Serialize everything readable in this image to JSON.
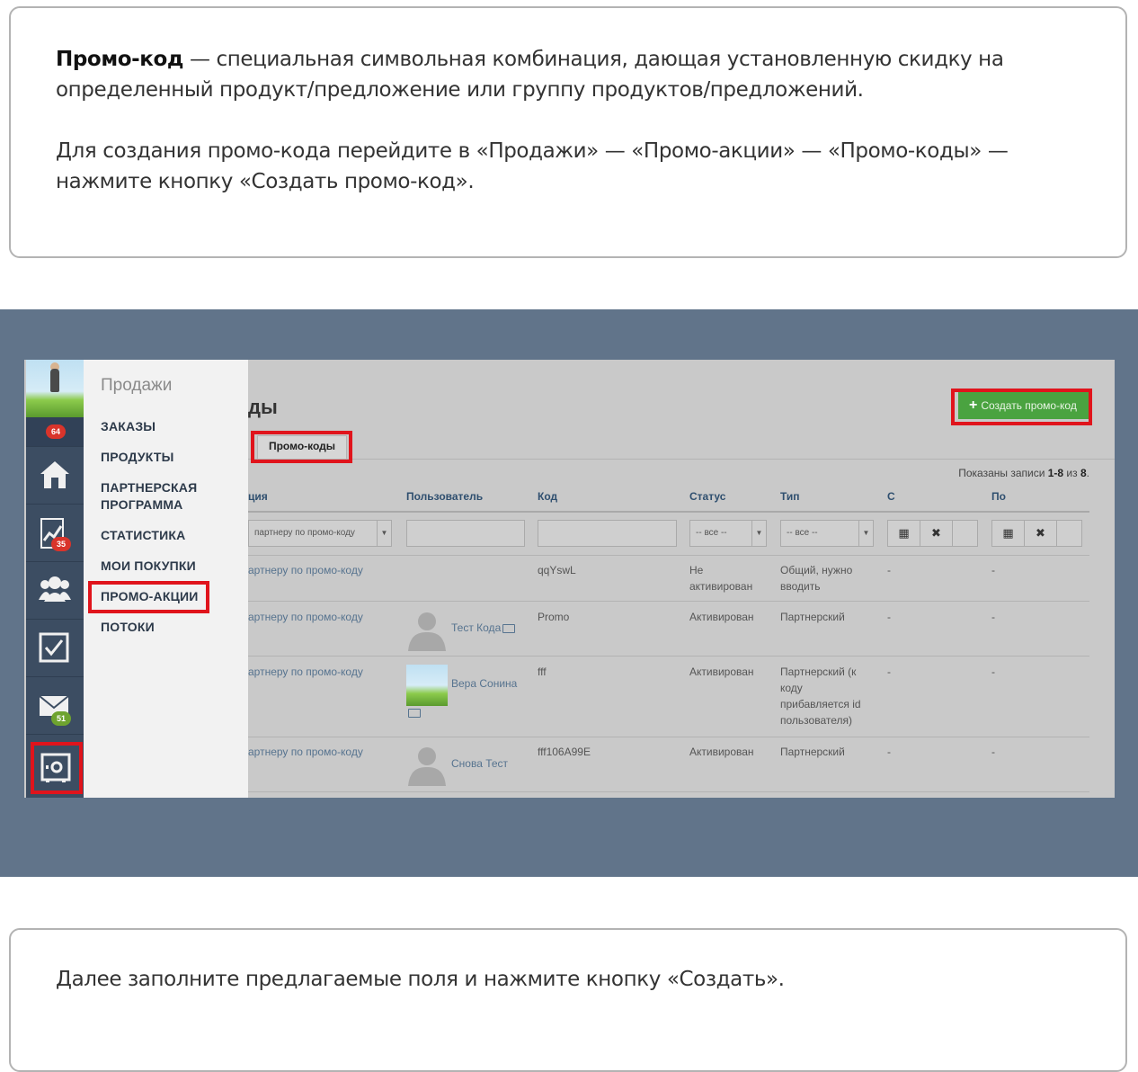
{
  "intro": {
    "term": "Промо-код",
    "definition": " — специальная символьная комбинация, дающая установленную скидку на определенный продукт/предложение или группу продуктов/предложений.",
    "instruction": "Для создания промо-кода перейдите в «Продажи» — «Промо-акции» — «Промо-коды» — нажмите кнопку «Создать промо-код»."
  },
  "outro": {
    "text": "Далее заполните предлагаемые поля и нажмите кнопку «Создать»."
  },
  "screenshot": {
    "iconbar": {
      "badges": {
        "top": "64",
        "stats": "35",
        "mail": "51"
      }
    },
    "menu": {
      "title": "Продажи",
      "items": [
        "ЗАКАЗЫ",
        "ПРОДУКТЫ",
        "ПАРТНЕРСКАЯ",
        "ПРОГРАММА",
        "СТАТИСТИКА",
        "МОИ ПОКУПКИ",
        "ПРОМО-АКЦИИ",
        "ПОТОКИ"
      ]
    },
    "page_title": "ды",
    "tab": "Промо-коды",
    "create_button": "Создать промо-код",
    "shown": {
      "prefix": "Показаны записи ",
      "range": "1-8",
      "mid": " из ",
      "total": "8",
      "suffix": "."
    },
    "columns": [
      "ция",
      "Пользователь",
      "Код",
      "Статус",
      "Тип",
      "С",
      "По"
    ],
    "filters": {
      "action": "партнеру по промо-коду",
      "status": "-- все --",
      "type": "-- все --"
    },
    "rows": [
      {
        "action": "артнеру по промо-коду",
        "user": "",
        "code": "qqYswL",
        "status1": "Не",
        "status2": "активирован",
        "type1": "Общий, нужно",
        "type2": "вводить",
        "type3": "",
        "type4": "",
        "from": "-",
        "to": "-"
      },
      {
        "action": "артнеру по промо-коду",
        "user": "Тест Кода",
        "code": "Promo",
        "status1": "Активирован",
        "status2": "",
        "type1": "Партнерский",
        "type2": "",
        "type3": "",
        "type4": "",
        "from": "-",
        "to": "-"
      },
      {
        "action": "артнеру по промо-коду",
        "user": "Вера Сонина",
        "code": "fff",
        "status1": "Активирован",
        "status2": "",
        "type1": "Партнерский (к",
        "type2": "коду",
        "type3": "прибавляется id",
        "type4": "пользователя)",
        "from": "-",
        "to": "-"
      },
      {
        "action": "артнеру по промо-коду",
        "user": "Снова Тест",
        "code": "fff106A99E",
        "status1": "Активирован",
        "status2": "",
        "type1": "Партнерский",
        "type2": "",
        "type3": "",
        "type4": "",
        "from": "-",
        "to": "-"
      }
    ]
  }
}
